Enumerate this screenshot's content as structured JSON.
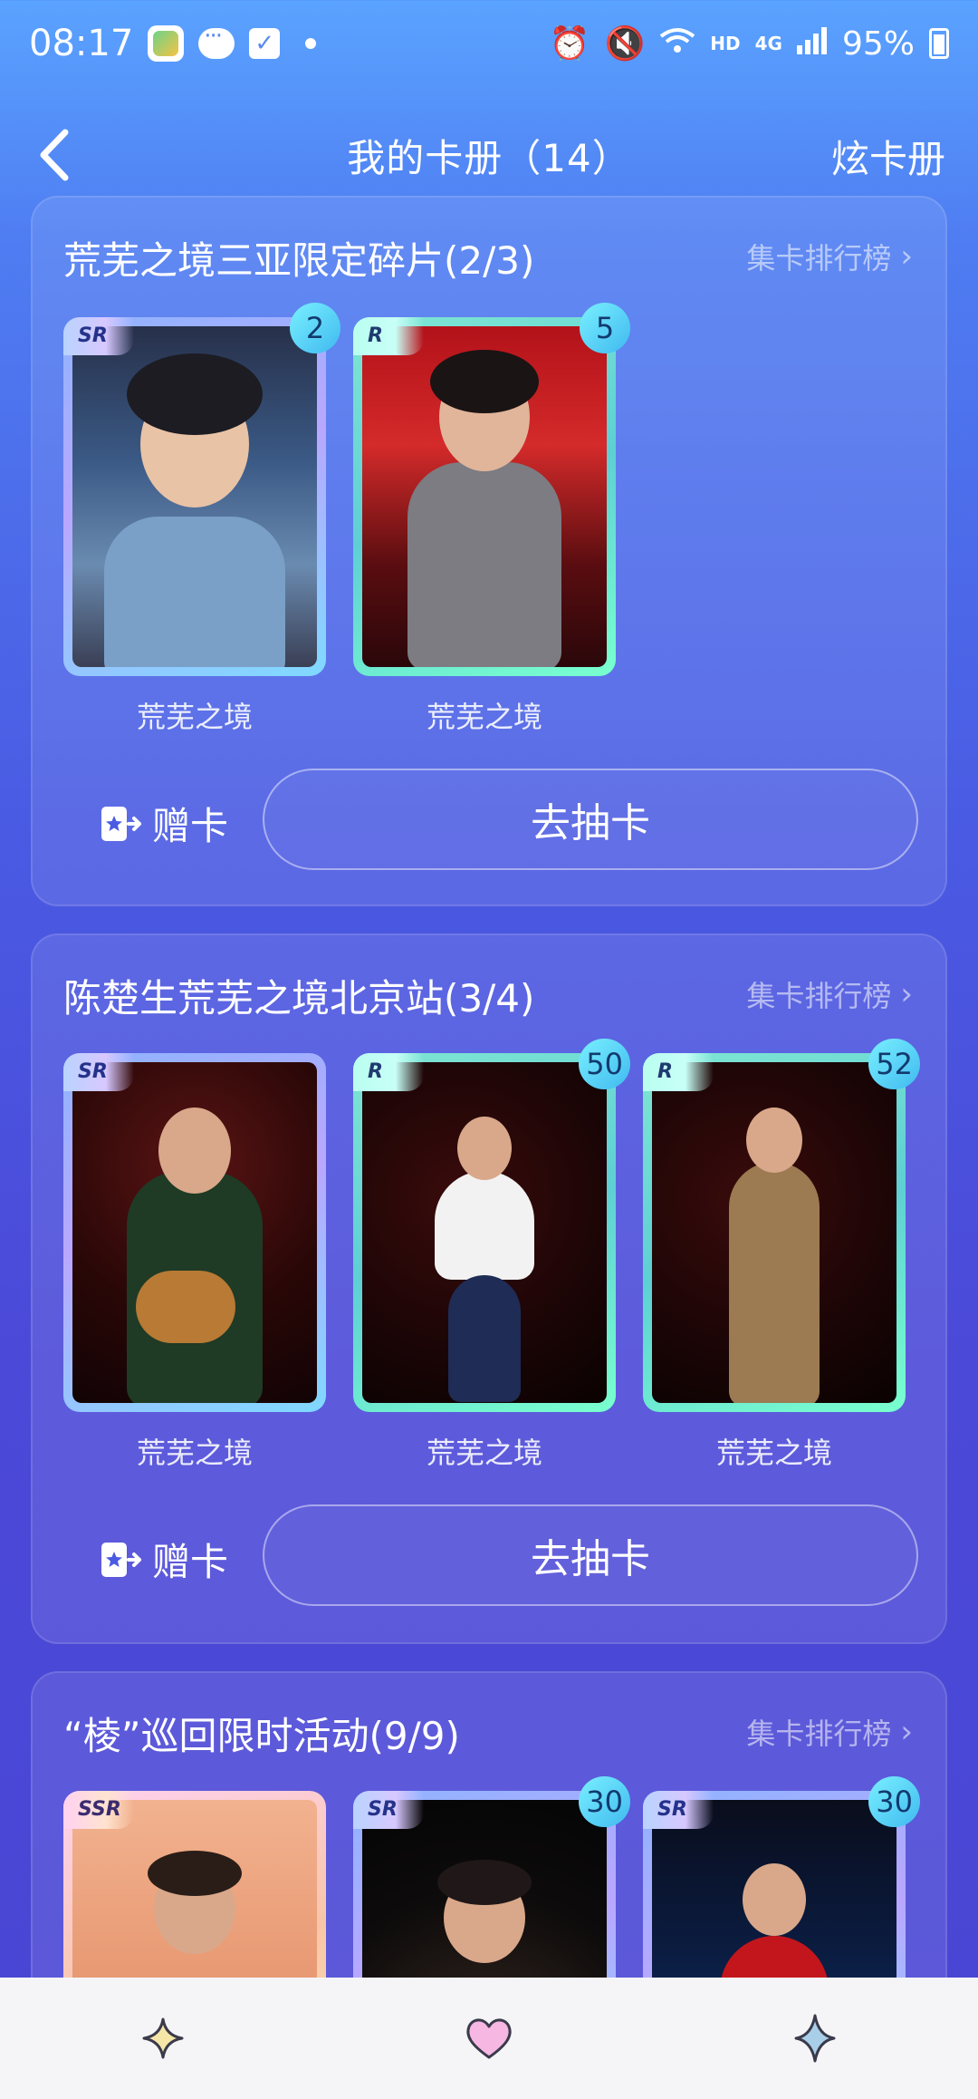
{
  "status": {
    "time": "08:17",
    "network": "HD",
    "signal": "4G",
    "battery": "95%"
  },
  "header": {
    "title": "我的卡册（14）",
    "right_action": "炫卡册"
  },
  "sections": [
    {
      "title": "荒芜之境三亚限定碎片(2/3)",
      "rank_link": "集卡排行榜",
      "cards": [
        {
          "rarity": "SR",
          "count": "2",
          "label": "荒芜之境"
        },
        {
          "rarity": "R",
          "count": "5",
          "label": "荒芜之境"
        }
      ],
      "gift_label": "赠卡",
      "draw_label": "去抽卡"
    },
    {
      "title": "陈楚生荒芜之境北京站(3/4)",
      "rank_link": "集卡排行榜",
      "cards": [
        {
          "rarity": "SR",
          "label": "荒芜之境"
        },
        {
          "rarity": "R",
          "count": "50",
          "label": "荒芜之境"
        },
        {
          "rarity": "R",
          "count": "52",
          "label": "荒芜之境"
        }
      ],
      "gift_label": "赠卡",
      "draw_label": "去抽卡"
    },
    {
      "title": "“棱”巡回限时活动(9/9)",
      "rank_link": "集卡排行榜",
      "cards": [
        {
          "rarity": "SSR"
        },
        {
          "rarity": "SR",
          "count": "30"
        },
        {
          "rarity": "SR",
          "count": "30"
        }
      ]
    }
  ],
  "bottom_nav": [
    "sparkle-icon",
    "heart-icon",
    "star-icon"
  ],
  "colors": {
    "accent": "#4a5be3",
    "badge": "#3fb9f0",
    "nav_bg": "#f5f5f8"
  }
}
